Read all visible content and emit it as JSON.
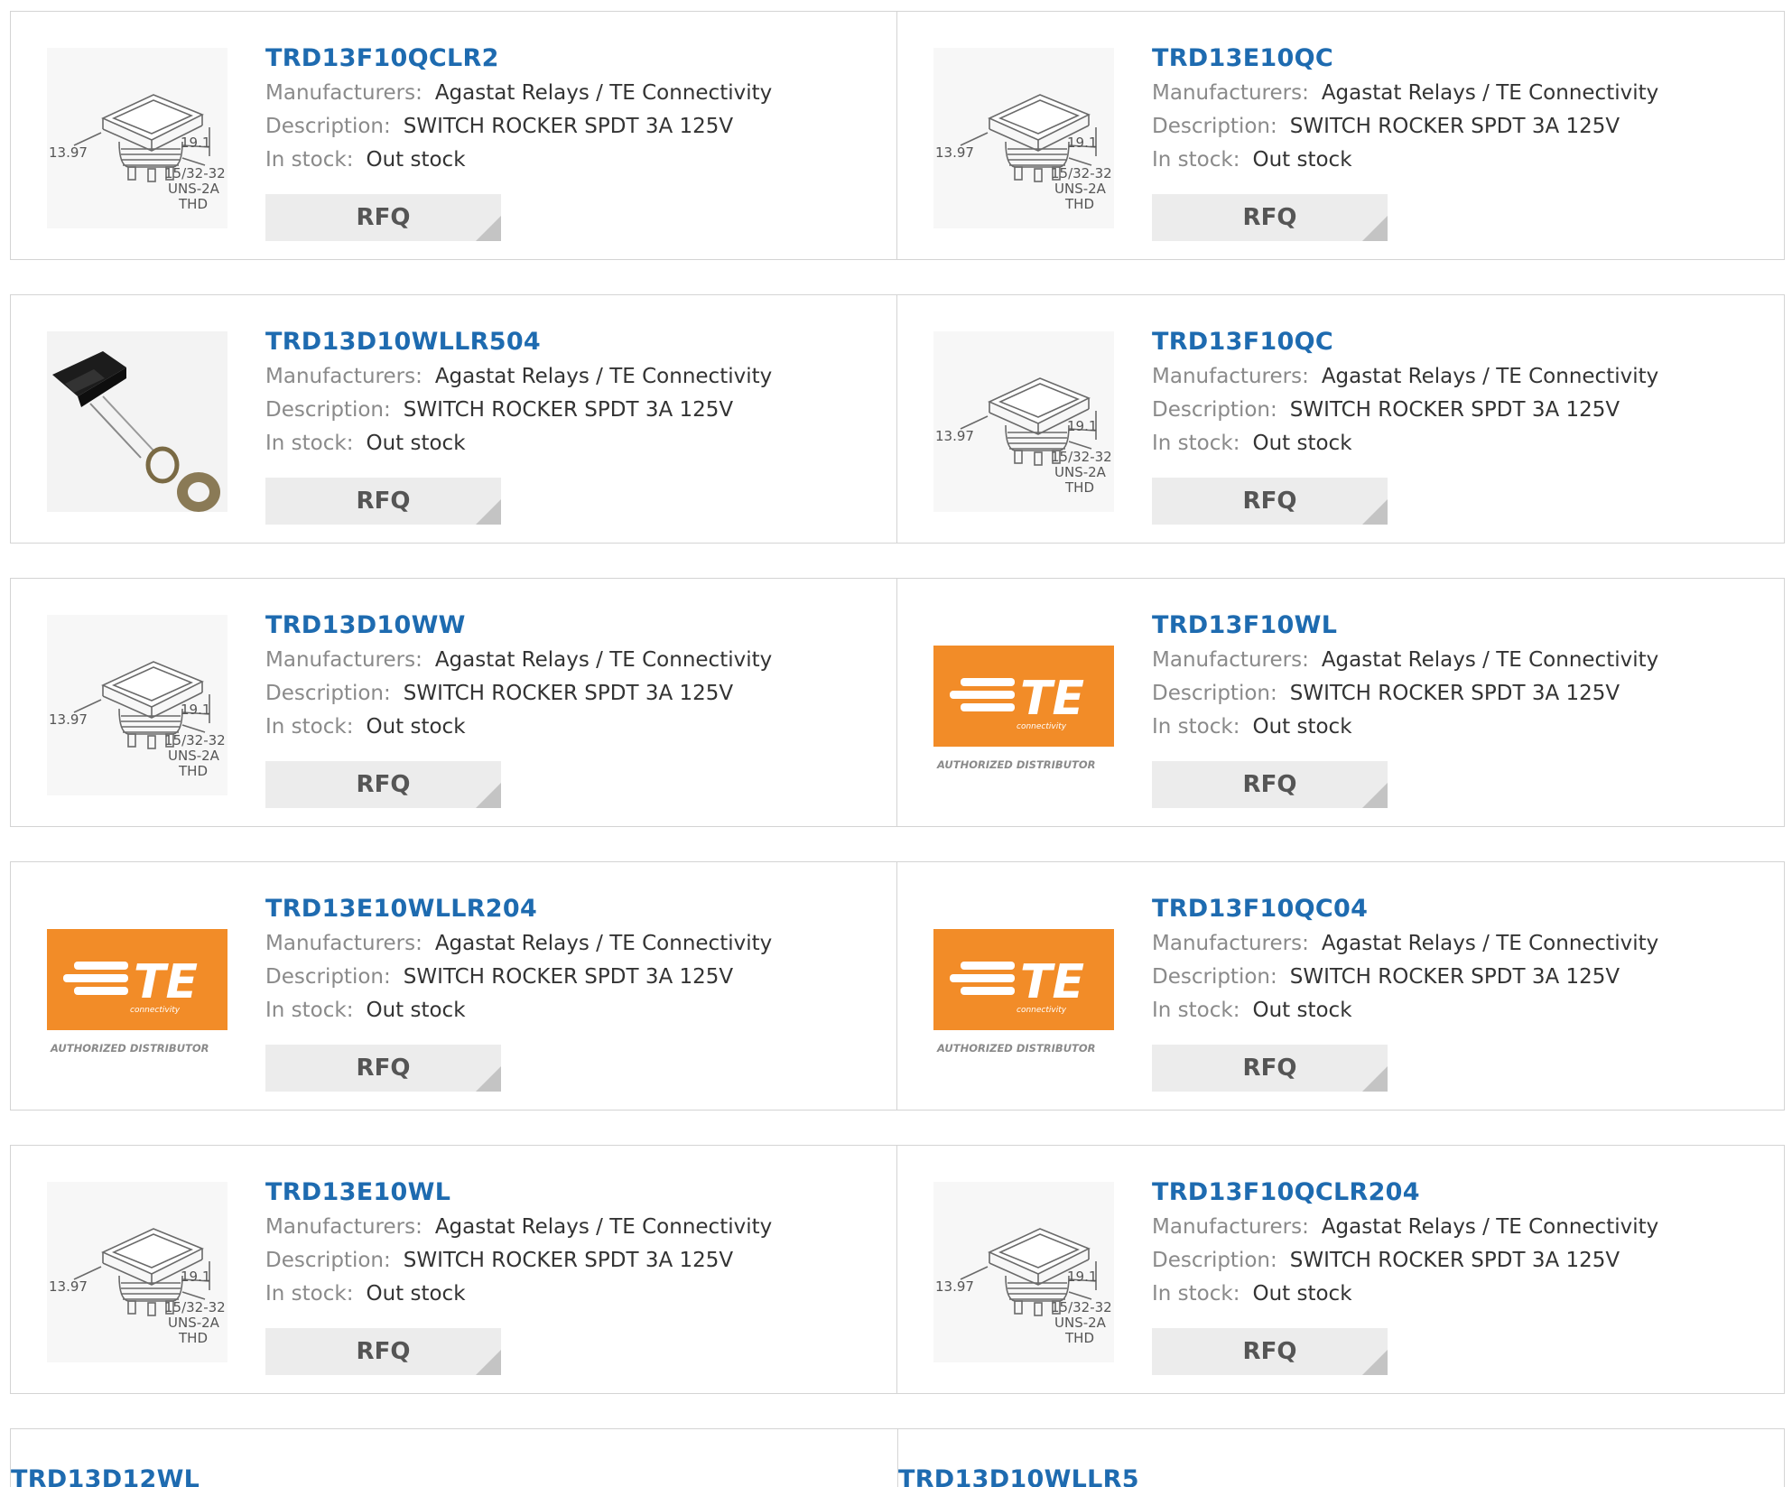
{
  "labels": {
    "manufacturers": "Manufacturers:",
    "description": "Description:",
    "in_stock": "In stock:",
    "rfq": "RFQ"
  },
  "products": [
    {
      "part": "TRD13F10QCLR2",
      "manufacturer": "Agastat Relays / TE Connectivity",
      "description": "SWITCH ROCKER SPDT 3A 125V",
      "stock": "Out stock",
      "image": "rocker-switch-drawing"
    },
    {
      "part": "TRD13E10QC",
      "manufacturer": "Agastat Relays / TE Connectivity",
      "description": "SWITCH ROCKER SPDT 3A 125V",
      "stock": "Out stock",
      "image": "rocker-switch-drawing"
    },
    {
      "part": "TRD13D10WLLR504",
      "manufacturer": "Agastat Relays / TE Connectivity",
      "description": "SWITCH ROCKER SPDT 3A 125V",
      "stock": "Out stock",
      "image": "rocker-switch-photo"
    },
    {
      "part": "TRD13F10QC",
      "manufacturer": "Agastat Relays / TE Connectivity",
      "description": "SWITCH ROCKER SPDT 3A 125V",
      "stock": "Out stock",
      "image": "rocker-switch-drawing"
    },
    {
      "part": "TRD13D10WW",
      "manufacturer": "Agastat Relays / TE Connectivity",
      "description": "SWITCH ROCKER SPDT 3A 125V",
      "stock": "Out stock",
      "image": "rocker-switch-drawing"
    },
    {
      "part": "TRD13F10WL",
      "manufacturer": "Agastat Relays / TE Connectivity",
      "description": "SWITCH ROCKER SPDT 3A 125V",
      "stock": "Out stock",
      "image": "te-logo"
    },
    {
      "part": "TRD13E10WLLR204",
      "manufacturer": "Agastat Relays / TE Connectivity",
      "description": "SWITCH ROCKER SPDT 3A 125V",
      "stock": "Out stock",
      "image": "te-logo"
    },
    {
      "part": "TRD13F10QC04",
      "manufacturer": "Agastat Relays / TE Connectivity",
      "description": "SWITCH ROCKER SPDT 3A 125V",
      "stock": "Out stock",
      "image": "te-logo"
    },
    {
      "part": "TRD13E10WL",
      "manufacturer": "Agastat Relays / TE Connectivity",
      "description": "SWITCH ROCKER SPDT 3A 125V",
      "stock": "Out stock",
      "image": "rocker-switch-drawing"
    },
    {
      "part": "TRD13F10QCLR204",
      "manufacturer": "Agastat Relays / TE Connectivity",
      "description": "SWITCH ROCKER SPDT 3A 125V",
      "stock": "Out stock",
      "image": "rocker-switch-drawing"
    }
  ],
  "partial_row": [
    "TRD13D12WL",
    "TRD13D10WLLR5"
  ],
  "drawing": {
    "dim_a": "13.97",
    "dim_b": "19.1",
    "thread_1": "15/32-32",
    "thread_2": "UNS-2A",
    "thread_3": "THD"
  },
  "te_logo": {
    "mark": "TE",
    "sub": "connectivity",
    "tagline": "AUTHORIZED DISTRIBUTOR",
    "color": "#f28c28"
  },
  "colors": {
    "link": "#1e6bb0",
    "label": "#8a8a8a",
    "border": "#d4d4d4",
    "button_bg": "#ececec"
  }
}
